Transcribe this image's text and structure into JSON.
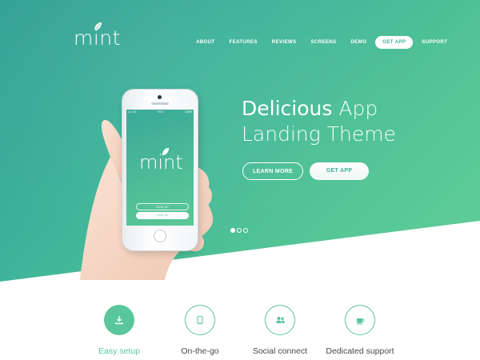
{
  "brand": {
    "name": "mint"
  },
  "nav": {
    "items": [
      {
        "label": "ABOUT"
      },
      {
        "label": "FEATURES"
      },
      {
        "label": "REVIEWS"
      },
      {
        "label": "SCREENS"
      },
      {
        "label": "DEMO"
      },
      {
        "label": "GET APP"
      },
      {
        "label": "SUPPORT"
      }
    ]
  },
  "hero": {
    "headline_strong": "Delicious",
    "headline_light": "App",
    "headline_line2": "Landing Theme",
    "learn_more": "LEARN MORE",
    "get_app": "GET APP",
    "slides": {
      "count": 3,
      "active": 1
    }
  },
  "phone": {
    "carrier": "•••• 3G",
    "time": "9:41",
    "battery": "100%",
    "app_name": "mint",
    "signup": "SIGN UP",
    "login": "LOG IN"
  },
  "features": [
    {
      "label": "Easy setup",
      "icon": "download-icon"
    },
    {
      "label": "On-the-go",
      "icon": "tablet-icon"
    },
    {
      "label": "Social connect",
      "icon": "people-icon"
    },
    {
      "label": "Dedicated support",
      "icon": "coffee-cup-icon"
    }
  ],
  "colors": {
    "accent": "#59c79b",
    "hero_start": "#2f9f93",
    "hero_end": "#61cf98",
    "text": "#444a4f"
  }
}
